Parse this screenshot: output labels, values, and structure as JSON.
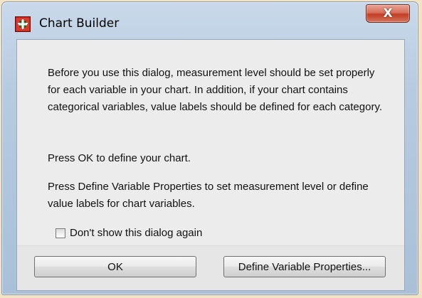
{
  "window": {
    "title": "Chart Builder",
    "app_icon": "spss-chart-icon",
    "close_glyph": "X"
  },
  "message": {
    "paragraph1": "Before you use this dialog, measurement level should be set properly for each variable in your chart. In addition, if your chart contains categorical variables, value labels should be defined for each category.",
    "paragraph2": "Press OK to define your chart.",
    "paragraph3": "Press Define Variable Properties to set measurement level or define value labels for chart variables."
  },
  "checkbox": {
    "label": "Don't show this dialog again",
    "checked": false
  },
  "buttons": {
    "ok_label": "OK",
    "define_label": "Define Variable Properties..."
  },
  "colors": {
    "close_button": "#c74a30",
    "title_bar": "#b9cde2",
    "dialog_body": "#ececec"
  }
}
